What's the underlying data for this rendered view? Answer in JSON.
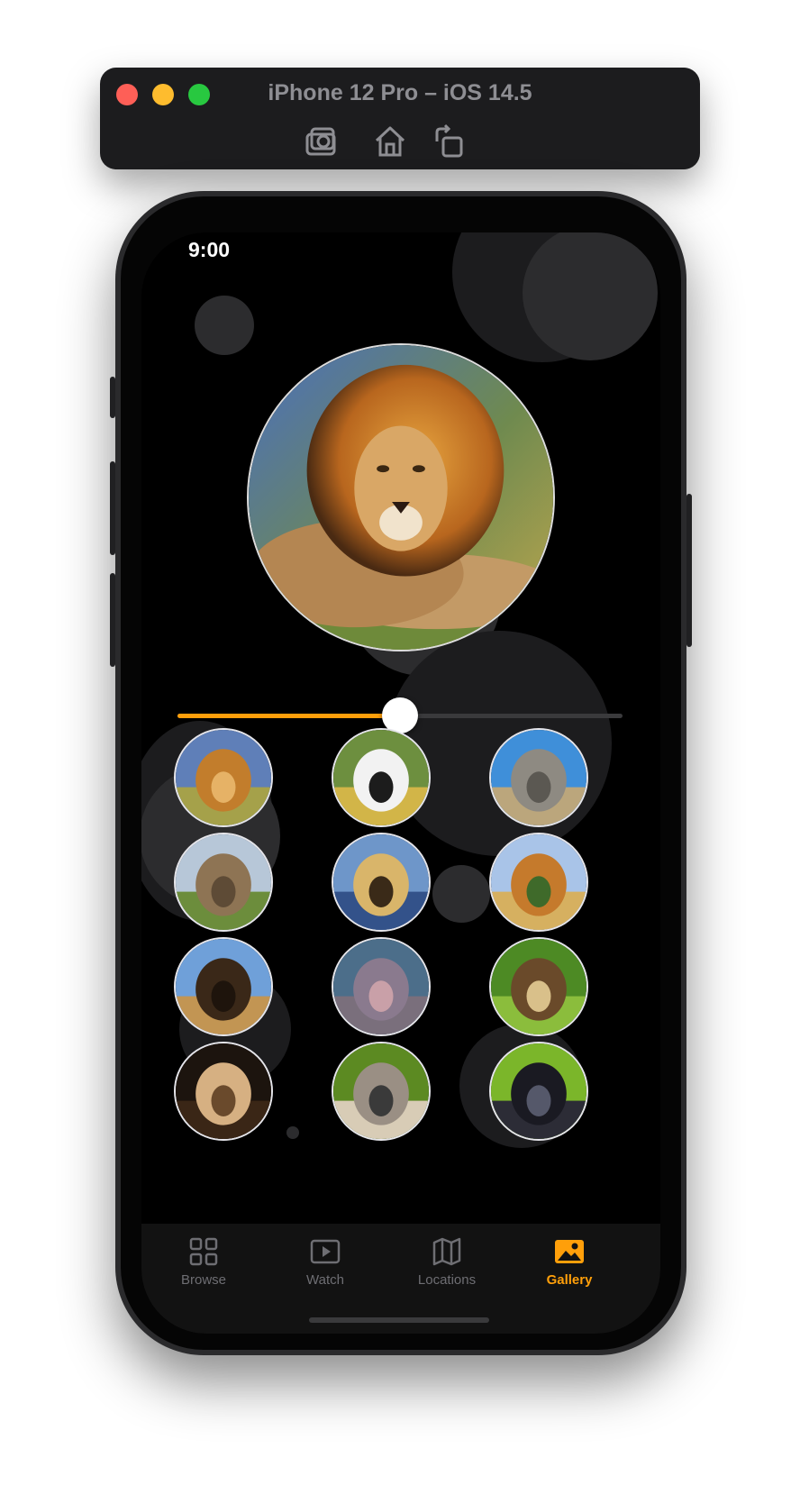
{
  "simulator": {
    "title": "iPhone 12 Pro – iOS 14.5",
    "tools": [
      {
        "name": "screenshot",
        "icon": "camera-icon"
      },
      {
        "name": "home",
        "icon": "home-icon"
      },
      {
        "name": "rotate",
        "icon": "rotate-icon"
      }
    ]
  },
  "status_bar": {
    "time": "9:00",
    "icons": [
      "signal-icon",
      "wifi-icon",
      "battery-icon"
    ]
  },
  "gallery": {
    "featured_image": "lion",
    "size_slider_value": 0.5,
    "thumbnails": [
      {
        "subject": "lion"
      },
      {
        "subject": "zebras"
      },
      {
        "subject": "rhinoceros"
      },
      {
        "subject": "elephants"
      },
      {
        "subject": "cheetah"
      },
      {
        "subject": "giraffes"
      },
      {
        "subject": "buffalo"
      },
      {
        "subject": "hippos"
      },
      {
        "subject": "wild dog"
      },
      {
        "subject": "meerkat"
      },
      {
        "subject": "ostrich"
      },
      {
        "subject": "gorilla"
      }
    ]
  },
  "tab_bar": {
    "tabs": [
      {
        "label": "Browse",
        "icon": "grid-icon"
      },
      {
        "label": "Watch",
        "icon": "play-icon"
      },
      {
        "label": "Locations",
        "icon": "map-icon"
      },
      {
        "label": "Gallery",
        "icon": "photo-icon"
      }
    ],
    "active": "Gallery"
  },
  "colors": {
    "accent": "#ff9f0a",
    "background": "#000000",
    "inactive_tab": "#6e6e73"
  }
}
